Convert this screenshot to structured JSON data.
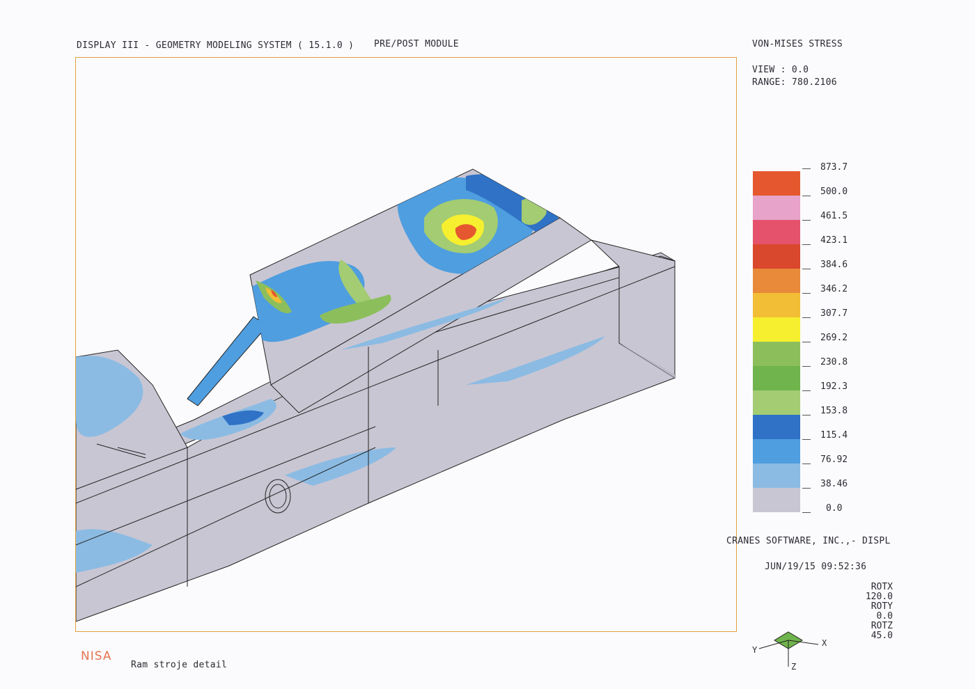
{
  "header": {
    "title": "DISPLAY III - GEOMETRY MODELING SYSTEM ( 15.1.0 )",
    "module": "PRE/POST MODULE"
  },
  "result": {
    "quantity": "VON-MISES STRESS",
    "view": "VIEW : 0.0",
    "range": "RANGE: 780.2106"
  },
  "legend": {
    "labels": [
      "873.7",
      "500.0",
      "461.5",
      "423.1",
      "384.6",
      "346.2",
      "307.7",
      "269.2",
      "230.8",
      "192.3",
      "153.8",
      "115.4",
      "76.92",
      "38.46",
      "0.0"
    ],
    "colors": [
      "#e5582f",
      "#e7a3c9",
      "#e4536b",
      "#d9472d",
      "#e88a3a",
      "#f2be35",
      "#f6ef2f",
      "#8cbf5c",
      "#6fb44c",
      "#a3cc73",
      "#2f72c6",
      "#4f9ee0",
      "#8bbbe3",
      "#c9c6d3"
    ]
  },
  "footer": {
    "company": "CRANES SOFTWARE, INC.,- DISPL",
    "timestamp": "JUN/19/15 09:52:36",
    "logo": "NISA",
    "model_name": "Ram stroje  detail"
  },
  "rotation": {
    "rotx_label": "ROTX",
    "rotx": "120.0",
    "roty_label": "ROTY",
    "roty": "0.0",
    "rotz_label": "ROTZ",
    "rotz": "45.0"
  },
  "triad": {
    "x": "X",
    "y": "Y",
    "z": "Z"
  },
  "colors": {
    "frame_border": "#e0a040",
    "mesh_gray": "#c9c6d3",
    "edge": "#222222",
    "logo": "#e5734f"
  }
}
